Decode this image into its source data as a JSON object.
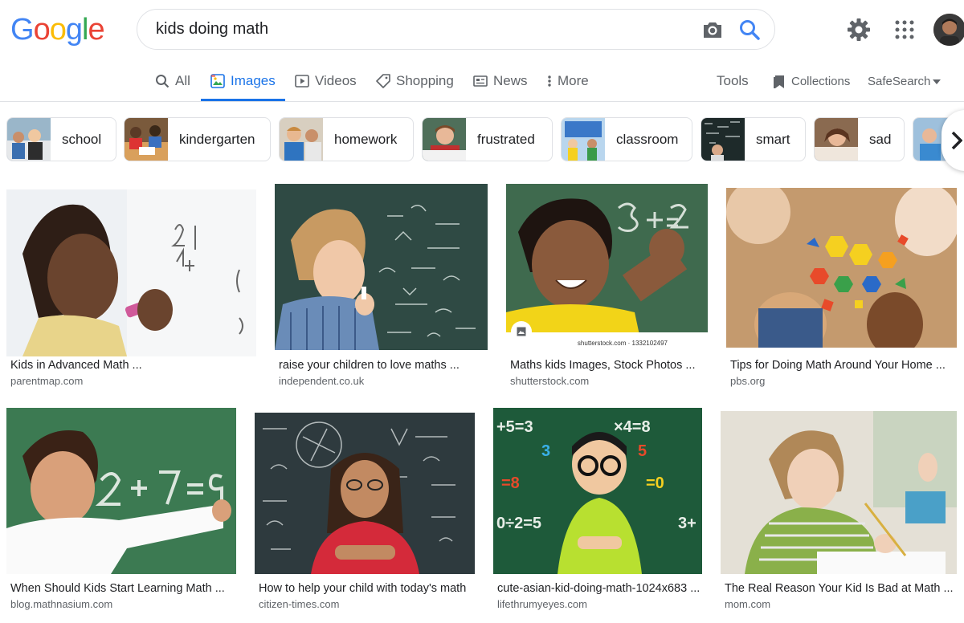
{
  "logo": {
    "letters": [
      "G",
      "o",
      "o",
      "g",
      "l",
      "e"
    ],
    "colors": [
      "#4285f4",
      "#ea4335",
      "#fbbc05",
      "#4285f4",
      "#34a853",
      "#ea4335"
    ]
  },
  "search": {
    "query": "kids doing math"
  },
  "tabs": [
    {
      "label": "All",
      "icon": "search-icon"
    },
    {
      "label": "Images",
      "icon": "image-icon",
      "active": true
    },
    {
      "label": "Videos",
      "icon": "play-icon"
    },
    {
      "label": "Shopping",
      "icon": "tag-icon"
    },
    {
      "label": "News",
      "icon": "newspaper-icon"
    },
    {
      "label": "More",
      "icon": "more-vert-icon"
    }
  ],
  "tools": {
    "tools_label": "Tools",
    "collections_label": "Collections",
    "safesearch_label": "SafeSearch"
  },
  "chips": [
    {
      "label": "school"
    },
    {
      "label": "kindergarten"
    },
    {
      "label": "homework"
    },
    {
      "label": "frustrated"
    },
    {
      "label": "classroom"
    },
    {
      "label": "smart"
    },
    {
      "label": "sad"
    }
  ],
  "results": [
    {
      "title": "Kids in Advanced Math ...",
      "site": "parentmap.com"
    },
    {
      "title": "raise your children to love maths ...",
      "site": "independent.co.uk"
    },
    {
      "title": "Maths kids Images, Stock Photos ...",
      "site": "shutterstock.com",
      "watermark": "shutterstock.com · 1332102497"
    },
    {
      "title": "Tips for Doing Math Around Your Home ...",
      "site": "pbs.org"
    },
    {
      "title": "When Should Kids Start Learning Math ...",
      "site": "blog.mathnasium.com"
    },
    {
      "title": "How to help your child with today's math",
      "site": "citizen-times.com"
    },
    {
      "title": "cute-asian-kid-doing-math-1024x683 ...",
      "site": "lifethrumyeyes.com"
    },
    {
      "title": "The Real Reason Your Kid Is Bad at Math ...",
      "site": "mom.com"
    }
  ],
  "colors": {
    "accent": "#1a73e8",
    "text_secondary": "#5f6368",
    "border": "#dfe1e5"
  }
}
